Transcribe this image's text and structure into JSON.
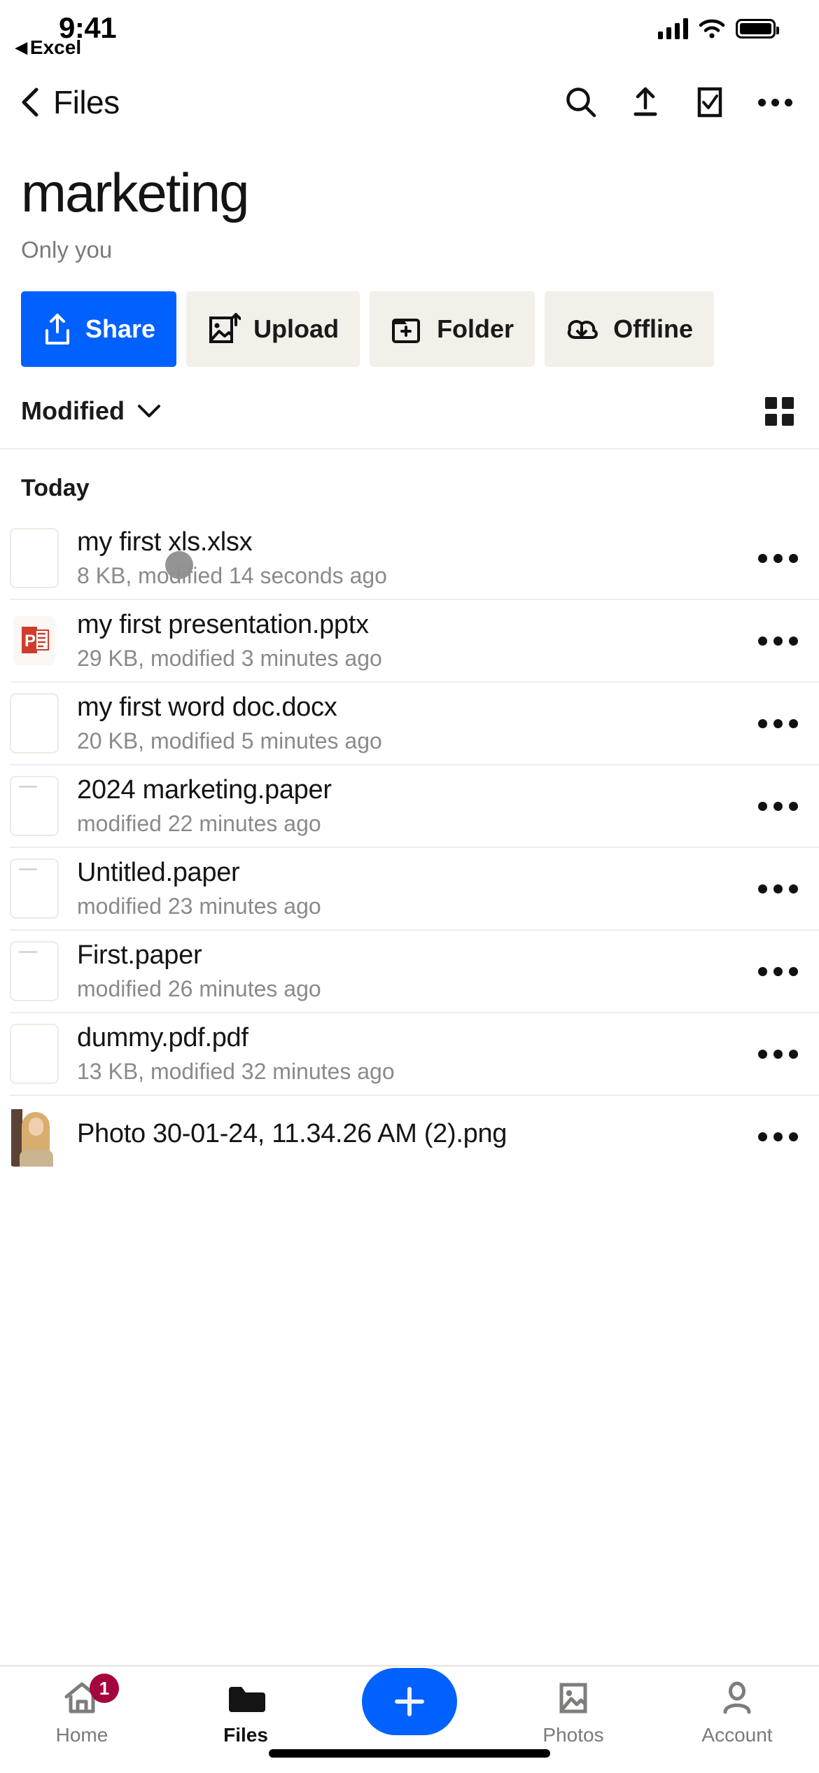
{
  "status_bar": {
    "time": "9:41",
    "back_to_app_label": "Excel",
    "back_to_app_arrow": "◀",
    "signal_icon": "cellular-signal-icon",
    "wifi_icon": "wifi-icon",
    "battery_icon": "battery-icon"
  },
  "nav_bar": {
    "back_label": "Files",
    "back_icon": "chevron-left-icon",
    "actions": [
      {
        "name": "search-icon",
        "label": "Search"
      },
      {
        "name": "upload-icon",
        "label": "Upload"
      },
      {
        "name": "select-checkbox-icon",
        "label": "Select"
      },
      {
        "name": "more-horizontal-icon",
        "label": "More"
      }
    ]
  },
  "header": {
    "title": "marketing",
    "subtitle": "Only you"
  },
  "action_buttons": [
    {
      "label": "Share",
      "icon": "share-icon",
      "primary": true
    },
    {
      "label": "Upload",
      "icon": "upload-image-icon",
      "primary": false
    },
    {
      "label": "Folder",
      "icon": "new-folder-icon",
      "primary": false
    },
    {
      "label": "Offline",
      "icon": "offline-cloud-icon",
      "primary": false
    }
  ],
  "sort_bar": {
    "sort_label": "Modified",
    "chevron_icon": "chevron-down-icon",
    "view_toggle_icon": "grid-view-icon"
  },
  "file_list": {
    "section_label": "Today",
    "items": [
      {
        "name": "my first xls.xlsx",
        "meta": "8 KB, modified 14 seconds ago",
        "icon": "excel-file-icon",
        "more_icon": "more-horizontal-icon"
      },
      {
        "name": "my first presentation.pptx",
        "meta": "29 KB, modified 3 minutes ago",
        "icon": "powerpoint-file-icon",
        "more_icon": "more-horizontal-icon"
      },
      {
        "name": "my first word doc.docx",
        "meta": "20 KB, modified 5 minutes ago",
        "icon": "word-file-icon",
        "more_icon": "more-horizontal-icon"
      },
      {
        "name": "2024 marketing.paper",
        "meta": "modified 22 minutes ago",
        "icon": "paper-file-icon",
        "more_icon": "more-horizontal-icon"
      },
      {
        "name": "Untitled.paper",
        "meta": "modified 23 minutes ago",
        "icon": "paper-file-icon",
        "more_icon": "more-horizontal-icon"
      },
      {
        "name": "First.paper",
        "meta": "modified 26 minutes ago",
        "icon": "paper-file-icon",
        "more_icon": "more-horizontal-icon"
      },
      {
        "name": "dummy.pdf.pdf",
        "meta": "13 KB, modified 32 minutes ago",
        "icon": "pdf-file-icon",
        "more_icon": "more-horizontal-icon"
      },
      {
        "name": "Photo 30-01-24, 11.34.26 AM (2).png",
        "meta": "",
        "icon": "photo-thumbnail",
        "more_icon": "more-horizontal-icon"
      }
    ]
  },
  "tab_bar": {
    "tabs": [
      {
        "label": "Home",
        "icon": "home-icon",
        "active": false,
        "badge": "1"
      },
      {
        "label": "Files",
        "icon": "folder-icon",
        "active": true,
        "badge": ""
      },
      {
        "label": "Photos",
        "icon": "photos-icon",
        "active": false,
        "badge": ""
      },
      {
        "label": "Account",
        "icon": "person-icon",
        "active": false,
        "badge": ""
      }
    ],
    "create_button": {
      "icon": "plus-icon",
      "label": "Create"
    }
  },
  "colors": {
    "accent_blue": "#0061fe",
    "chip_bg": "#f3efe9",
    "badge_crimson": "#a5053f",
    "muted_text": "#8a8a88"
  }
}
